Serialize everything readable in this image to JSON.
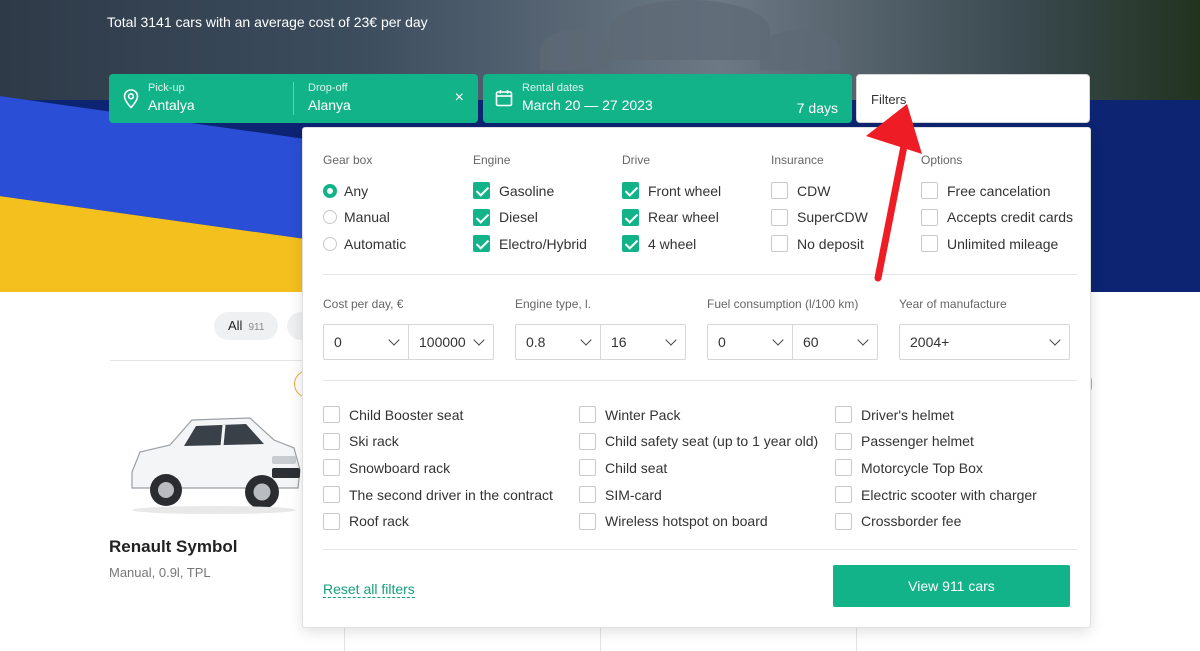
{
  "hero": {
    "subtitle": "Total 3141 cars with an average cost of 23€ per day"
  },
  "search": {
    "pickup_label": "Pick-up",
    "pickup_value": "Antalya",
    "dropoff_label": "Drop-off",
    "dropoff_value": "Alanya",
    "clear_icon": "×",
    "dates_label": "Rental dates",
    "dates_value": "March 20 — 27 2023",
    "days": "7 days",
    "filters_label": "Filters"
  },
  "filters": {
    "gearbox": {
      "title": "Gear box",
      "options": [
        {
          "label": "Any",
          "checked": true
        },
        {
          "label": "Manual",
          "checked": false
        },
        {
          "label": "Automatic",
          "checked": false
        }
      ]
    },
    "engine": {
      "title": "Engine",
      "options": [
        {
          "label": "Gasoline",
          "checked": true
        },
        {
          "label": "Diesel",
          "checked": true
        },
        {
          "label": "Electro/Hybrid",
          "checked": true
        }
      ]
    },
    "drive": {
      "title": "Drive",
      "options": [
        {
          "label": "Front wheel",
          "checked": true
        },
        {
          "label": "Rear wheel",
          "checked": true
        },
        {
          "label": "4 wheel",
          "checked": true
        }
      ]
    },
    "insurance": {
      "title": "Insurance",
      "options": [
        {
          "label": "CDW",
          "checked": false
        },
        {
          "label": "SuperCDW",
          "checked": false
        },
        {
          "label": "No deposit",
          "checked": false
        }
      ]
    },
    "options": {
      "title": "Options",
      "options": [
        {
          "label": "Free cancelation",
          "checked": false
        },
        {
          "label": "Accepts credit cards",
          "checked": false
        },
        {
          "label": "Unlimited mileage",
          "checked": false
        }
      ]
    },
    "cost": {
      "title": "Cost per day, €",
      "min": "0",
      "max": "100000"
    },
    "engine_type": {
      "title": "Engine type, l.",
      "min": "0.8",
      "max": "16"
    },
    "fuel": {
      "title": "Fuel consumption (l/100 km)",
      "min": "0",
      "max": "60"
    },
    "year": {
      "title": "Year of manufacture",
      "value": "2004+"
    },
    "extras": {
      "col1": [
        "Child Booster seat",
        "Ski rack",
        "Snowboard rack",
        "The second driver in the contract",
        "Roof rack"
      ],
      "col2": [
        "Winter Pack",
        "Child safety seat (up to 1 year old)",
        "Child seat",
        "SIM-card",
        "Wireless hotspot on board"
      ],
      "col3": [
        "Driver's helmet",
        "Passenger helmet",
        "Motorcycle Top Box",
        "Electric scooter with charger",
        "Crossborder fee"
      ]
    },
    "reset_label": "Reset all filters",
    "view_label": "View 911 cars"
  },
  "results": {
    "chip_label": "All",
    "chip_count": "911",
    "car_name": "Renault Symbol",
    "car_sub": "Manual, 0.9l, TPL"
  },
  "colors": {
    "accent": "#13b38a",
    "arrow": "#ee1c25"
  }
}
